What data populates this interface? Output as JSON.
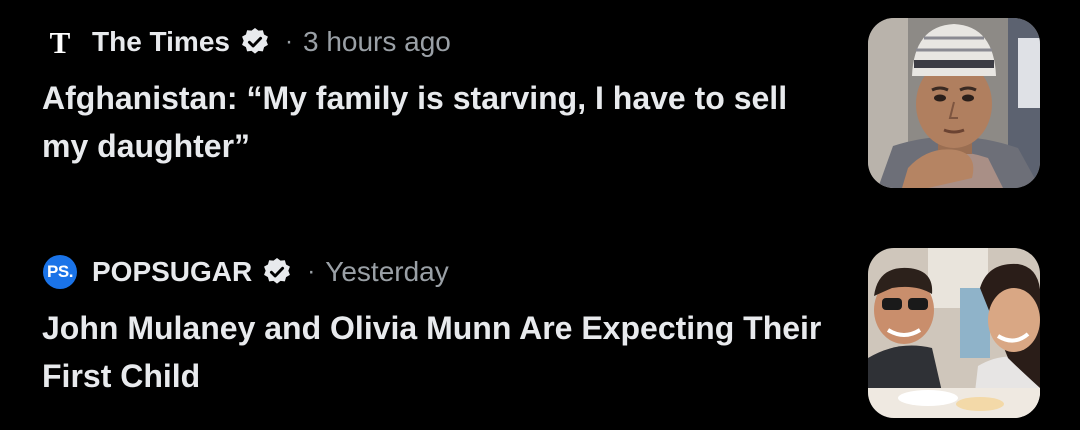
{
  "articles": [
    {
      "source": "The Times",
      "logo": "T",
      "verified_icon": "verified-check-icon",
      "separator": "·",
      "time": "3 hours ago",
      "headline": "Afghanistan: “My family is starving, I have to sell my daughter”",
      "thumbnail": "boy-in-skullcap-photo"
    },
    {
      "source": "POPSUGAR",
      "logo": "PS.",
      "verified_icon": "verified-check-icon",
      "separator": "·",
      "time": "Yesterday",
      "headline": "John Mulaney and Olivia Munn Are Expecting Their First Child",
      "thumbnail": "couple-smiling-photo"
    }
  ],
  "colors": {
    "background": "#000000",
    "text": "#e8eaed",
    "secondary": "#9aa0a6",
    "popsugar_logo": "#1a73e8"
  }
}
